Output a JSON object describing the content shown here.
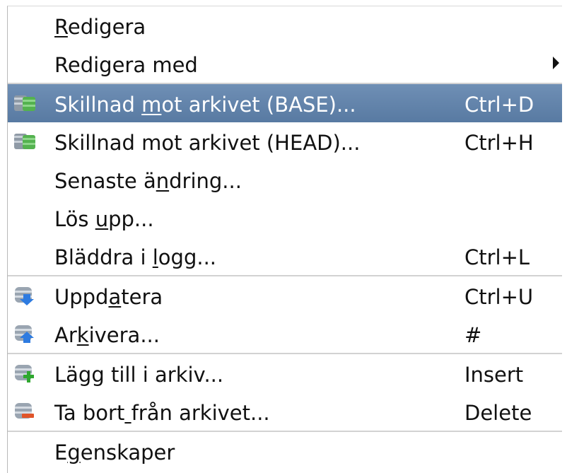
{
  "menu": {
    "items": [
      {
        "label": "Redigera",
        "u": 0,
        "accel": ""
      },
      {
        "label": "Redigera med",
        "u": -1,
        "accel": ""
      },
      {
        "label": "Skillnad mot arkivet (BASE)...",
        "u": 9,
        "accel": "Ctrl+D"
      },
      {
        "label": "Skillnad mot arkivet (HEAD)...",
        "u": -1,
        "accel": "Ctrl+H"
      },
      {
        "label": "Senaste ändring...",
        "u": 9,
        "accel": ""
      },
      {
        "label": "Lös upp...",
        "u": 4,
        "accel": ""
      },
      {
        "label": "Bläddra i logg...",
        "u": 10,
        "accel": "Ctrl+L"
      },
      {
        "label": "Uppdatera",
        "u": 4,
        "accel": "Ctrl+U"
      },
      {
        "label": "Arkivera...",
        "u": 2,
        "accel": "#"
      },
      {
        "label": "Lägg till i arkiv...",
        "u": -1,
        "accel": "Insert"
      },
      {
        "label": "Ta bort från arkivet...",
        "u": 7,
        "accel": "Delete"
      },
      {
        "label": "Egenskaper",
        "u": 1,
        "accel": ""
      }
    ],
    "icons": {
      "diff": "diff-repository-icon",
      "update": "update-icon",
      "commit": "commit-icon",
      "add": "add-to-repository-icon",
      "remove": "remove-from-repository-icon"
    },
    "colors": {
      "selection": "#6382ab",
      "separator": "#d2d2d2",
      "text": "#111111"
    }
  }
}
